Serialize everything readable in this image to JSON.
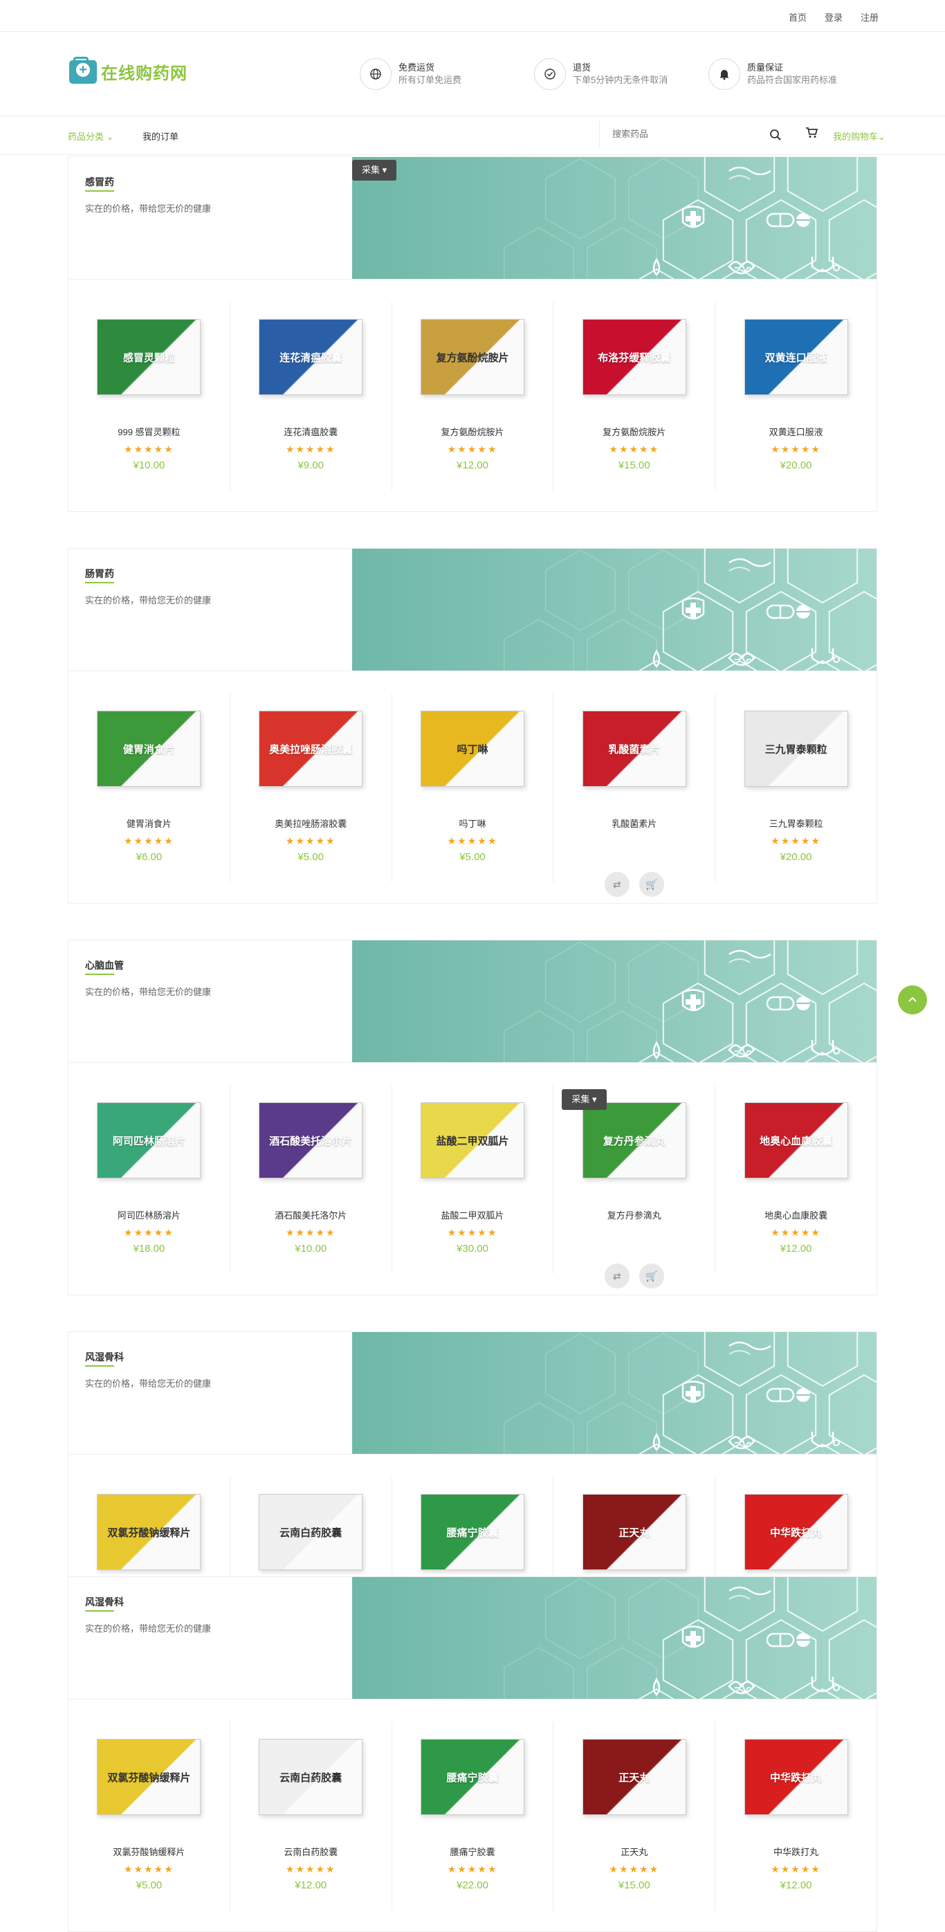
{
  "toplinks": {
    "home": "首页",
    "login": "登录",
    "register": "注册"
  },
  "logo": {
    "text": "在线购药网"
  },
  "features": [
    {
      "icon": "globe-icon",
      "title": "免费运货",
      "desc": "所有订单免运费"
    },
    {
      "icon": "check-circle-icon",
      "title": "退货",
      "desc": "下单5分钟内无条件取消"
    },
    {
      "icon": "bell-icon",
      "title": "质量保证",
      "desc": "药品符合国家用药标准"
    }
  ],
  "nav": {
    "category": "药品分类",
    "orders": "我的订单",
    "cart": "我的购物车"
  },
  "search": {
    "placeholder": "搜索药品"
  },
  "collect_label": "采集",
  "sections": [
    {
      "title": "感冒药",
      "subtitle": "实在的价格，带给您无价的健康",
      "products": [
        {
          "name": "999 感冒灵颗粒",
          "stars": "★★★★★",
          "price": "¥10.00",
          "box_text": "感冒灵颗粒",
          "box_color": "#2e8b3e"
        },
        {
          "name": "连花清瘟胶囊",
          "stars": "★★★★★",
          "price": "¥9.00",
          "box_text": "连花清瘟胶囊",
          "box_color": "#2a5fa8"
        },
        {
          "name": "复方氨酚烷胺片",
          "stars": "★★★★★",
          "price": "¥12.00",
          "box_text": "复方氨酚烷胺片",
          "box_color": "#c8a040"
        },
        {
          "name": "复方氨酚烷胺片",
          "stars": "★★★★★",
          "price": "¥15.00",
          "box_text": "布洛芬缓释胶囊",
          "box_color": "#c8102e"
        },
        {
          "name": "双黄连口服液",
          "stars": "★★★★★",
          "price": "¥20.00",
          "box_text": "双黄连口服液",
          "box_color": "#1f6fb4"
        }
      ]
    },
    {
      "title": "肠胃药",
      "subtitle": "实在的价格，带给您无价的健康",
      "products": [
        {
          "name": "健胃消食片",
          "stars": "★★★★★",
          "price": "¥6.00",
          "box_text": "健胃消食片",
          "box_color": "#3d9a3a"
        },
        {
          "name": "奥美拉唑肠溶胶囊",
          "stars": "★★★★★",
          "price": "¥5.00",
          "box_text": "奥美拉唑肠溶胶囊",
          "box_color": "#d9342b"
        },
        {
          "name": "吗丁啉",
          "stars": "★★★★★",
          "price": "¥5.00",
          "box_text": "吗丁啉",
          "box_color": "#e8b820"
        },
        {
          "name": "乳酸菌素片",
          "stars": "",
          "price": "",
          "box_text": "乳酸菌素片",
          "box_color": "#c81e2a"
        },
        {
          "name": "三九胃泰颗粒",
          "stars": "★★★★★",
          "price": "¥20.00",
          "box_text": "三九胃泰颗粒",
          "box_color": "#e9e9e9"
        }
      ]
    },
    {
      "title": "心脑血管",
      "subtitle": "实在的价格，带给您无价的健康",
      "products": [
        {
          "name": "阿司匹林肠溶片",
          "stars": "★★★★★",
          "price": "¥18.00",
          "box_text": "阿司匹林肠溶片",
          "box_color": "#3aa77a"
        },
        {
          "name": "酒石酸美托洛尔片",
          "stars": "★★★★★",
          "price": "¥10.00",
          "box_text": "酒石酸美托洛尔片",
          "box_color": "#5a3a8a"
        },
        {
          "name": "盐酸二甲双胍片",
          "stars": "★★★★★",
          "price": "¥30.00",
          "box_text": "盐酸二甲双胍片",
          "box_color": "#e8d84a"
        },
        {
          "name": "复方丹参滴丸",
          "stars": "",
          "price": "",
          "box_text": "复方丹参滴丸",
          "box_color": "#3d9a3a"
        },
        {
          "name": "地奥心血康胶囊",
          "stars": "★★★★★",
          "price": "¥12.00",
          "box_text": "地奥心血康胶囊",
          "box_color": "#c81e2a"
        }
      ]
    },
    {
      "title": "风湿骨科",
      "subtitle": "实在的价格，带给您无价的健康",
      "products": [
        {
          "name": "",
          "stars": "",
          "price": "",
          "box_text": "双氯芬酸钠缓释片",
          "box_color": "#e8c830"
        },
        {
          "name": "",
          "stars": "",
          "price": "",
          "box_text": "云南白药胶囊",
          "box_color": "#f0f0f0"
        },
        {
          "name": "",
          "stars": "",
          "price": "",
          "box_text": "腰痛宁胶囊",
          "box_color": "#2e9a48"
        },
        {
          "name": "",
          "stars": "",
          "price": "",
          "box_text": "正天丸",
          "box_color": "#8a1a1a"
        },
        {
          "name": "",
          "stars": "",
          "price": "",
          "box_text": "中华跌打丸",
          "box_color": "#d81e1e"
        }
      ]
    },
    {
      "title": "风湿骨科",
      "subtitle": "实在的价格，带给您无价的健康",
      "products": [
        {
          "name": "双氯芬酸钠缓释片",
          "stars": "★★★★★",
          "price": "¥5.00",
          "box_text": "双氯芬酸钠缓释片",
          "box_color": "#e8c830"
        },
        {
          "name": "云南白药胶囊",
          "stars": "★★★★★",
          "price": "¥12.00",
          "box_text": "云南白药胶囊",
          "box_color": "#f0f0f0"
        },
        {
          "name": "腰痛宁胶囊",
          "stars": "★★★★★",
          "price": "¥22.00",
          "box_text": "腰痛宁胶囊",
          "box_color": "#2e9a48"
        },
        {
          "name": "正天丸",
          "stars": "★★★★★",
          "price": "¥15.00",
          "box_text": "正天丸",
          "box_color": "#8a1a1a"
        },
        {
          "name": "中华跌打丸",
          "stars": "★★★★★",
          "price": "¥12.00",
          "box_text": "中华跌打丸",
          "box_color": "#d81e1e"
        }
      ]
    }
  ]
}
